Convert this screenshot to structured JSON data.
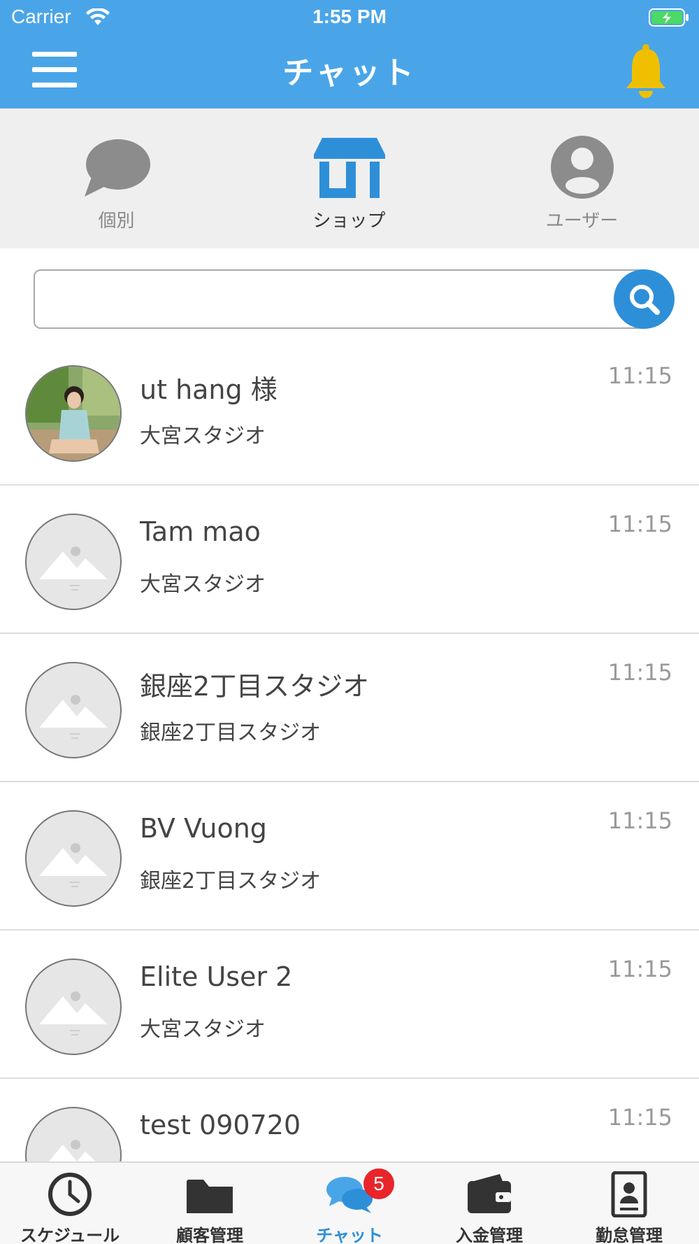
{
  "status_bar": {
    "carrier": "Carrier",
    "time": "1:55 PM"
  },
  "header": {
    "title": "チャット",
    "accent_color": "#4aa5e8",
    "menu_icon": "hamburger-icon",
    "bell_icon": "bell-icon"
  },
  "segments": [
    {
      "label": "個別",
      "icon": "speech-bubble-icon",
      "active": false
    },
    {
      "label": "ショップ",
      "icon": "shop-icon",
      "active": true
    },
    {
      "label": "ユーザー",
      "icon": "user-icon",
      "active": false
    }
  ],
  "search": {
    "value": "",
    "placeholder": "",
    "icon": "search-icon"
  },
  "chats": [
    {
      "name": "ut hang 様",
      "shop": "大宮スタジオ",
      "time": "11:15",
      "avatar": "photo"
    },
    {
      "name": "Tam mao",
      "shop": "大宮スタジオ",
      "time": "11:15",
      "avatar": "placeholder-image"
    },
    {
      "name": "銀座2丁目スタジオ",
      "shop": "銀座2丁目スタジオ",
      "time": "11:15",
      "avatar": "placeholder-image"
    },
    {
      "name": "BV Vuong",
      "shop": "銀座2丁目スタジオ",
      "time": "11:15",
      "avatar": "placeholder-image"
    },
    {
      "name": "Elite User 2",
      "shop": "大宮スタジオ",
      "time": "11:15",
      "avatar": "placeholder-image"
    },
    {
      "name": "test 090720",
      "shop": "",
      "time": "11:15",
      "avatar": "placeholder-image"
    }
  ],
  "tabbar": {
    "items": [
      {
        "label": "スケジュール",
        "icon": "clock-icon",
        "active": false
      },
      {
        "label": "顧客管理",
        "icon": "folder-icon",
        "active": false
      },
      {
        "label": "チャット",
        "icon": "chat-bubbles-icon",
        "active": true,
        "badge": "5"
      },
      {
        "label": "入金管理",
        "icon": "wallet-icon",
        "active": false
      },
      {
        "label": "勤怠管理",
        "icon": "id-card-icon",
        "active": false
      }
    ],
    "active_color": "#2e8fd9",
    "badge_color": "#e8252a"
  }
}
